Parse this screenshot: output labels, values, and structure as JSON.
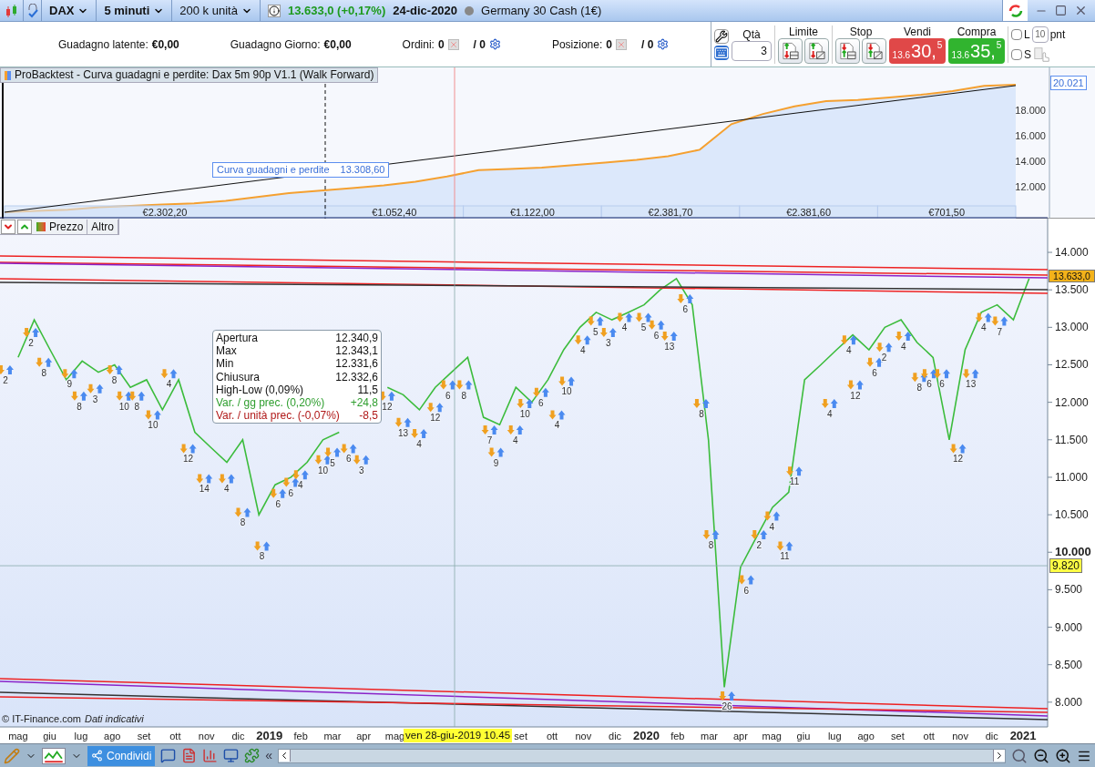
{
  "toolbar": {
    "symbol": "DAX",
    "timeframe": "5 minuti",
    "units": "200 k unità",
    "quote": "13.633,0 (+0,17%)",
    "date": "24-dic-2020",
    "instrument": "Germany 30 Cash (1€)"
  },
  "account": [
    {
      "kind": "value",
      "label": "Guadagno latente:",
      "value": "€0,00"
    },
    {
      "kind": "value",
      "label": "Guadagno Giorno:",
      "value": "€0,00"
    },
    {
      "kind": "count",
      "label": "Ordini:",
      "value": "0",
      "pending": "/ 0"
    },
    {
      "kind": "count",
      "label": "Posizione:",
      "value": "0",
      "pending": "/ 0"
    }
  ],
  "order_panel": {
    "qty_label": "Qtà",
    "qty": "3",
    "limit_label": "Limite",
    "stop_label": "Stop",
    "sell": {
      "label": "Vendi",
      "prefix": "13.6",
      "big": "30,",
      "fraction": "5"
    },
    "buy": {
      "label": "Compra",
      "prefix": "13.6",
      "big": "35,",
      "fraction": "5"
    },
    "options": [
      {
        "label": "L",
        "checked": false
      },
      {
        "label": "S",
        "checked": false
      }
    ],
    "points": "10",
    "points_unit": "pnt"
  },
  "equity_pane": {
    "title": "ProBacktest - Curva guadagni e perdite: Dax 5m 90p V1.1 (Walk Forward)",
    "tooltip_value": "13.308,60",
    "last_value": "20.021",
    "periods": [
      "€2.302,20",
      "€1.052,40",
      "€1.122,00",
      "€2.381,70",
      "€2.381,60",
      "€701,50"
    ],
    "chart_data": {
      "type": "area",
      "categories": [
        null,
        null,
        null,
        null,
        null,
        null,
        null,
        null,
        null,
        null,
        null,
        null,
        null,
        null,
        null,
        null,
        null,
        null,
        null,
        null,
        null,
        null,
        null,
        null,
        null,
        null,
        null,
        null,
        null,
        null,
        null,
        null,
        null
      ],
      "series": [
        {
          "name": "Curva guadagni e perdite",
          "color": "#f5a030",
          "values": [
            10000,
            10100,
            10200,
            10400,
            10500,
            10600,
            10700,
            10900,
            11200,
            11500,
            11700,
            11900,
            12100,
            12400,
            12800,
            13300,
            13400,
            13500,
            13700,
            13900,
            14100,
            14400,
            14900,
            16900,
            17700,
            18300,
            18700,
            18800,
            19000,
            19200,
            19500,
            19900,
            20000
          ]
        }
      ],
      "ylim": [
        9500,
        21350
      ],
      "yticks": [
        {
          "value": 12000,
          "label": "12.000"
        },
        {
          "value": 14000,
          "label": "14.000"
        },
        {
          "value": 16000,
          "label": "16.000"
        },
        {
          "value": 18000,
          "label": "18.000"
        }
      ]
    }
  },
  "price_tabs": [
    "Prezzo",
    "Altro"
  ],
  "price_pane": {
    "last_price": "13.633,0",
    "cursor_price": "9.820",
    "cursor_date": "ven 28-giu-2019 10.45",
    "copyright": "© IT-Finance.com",
    "disclaimer": "Dati indicativi",
    "tooltip": [
      {
        "kind": "plain",
        "label": "Apertura",
        "value": "12.340,9"
      },
      {
        "kind": "plain",
        "label": "Max",
        "value": "12.343,1"
      },
      {
        "kind": "plain",
        "label": "Min",
        "value": "12.331,6"
      },
      {
        "kind": "plain",
        "label": "Chiusura",
        "value": "12.332,6"
      },
      {
        "kind": "plain",
        "label": "High-Low (0,09%)",
        "value": "11,5"
      },
      {
        "kind": "up",
        "label": "Var. / gg prec. (0,20%)",
        "value": "+24,8"
      },
      {
        "kind": "down",
        "label": "Var. / unità prec. (-0,07%)",
        "value": "-8,5"
      }
    ],
    "trade_markers": [
      "2",
      "2",
      "8",
      "9",
      "8",
      "3",
      "8",
      "10",
      "8",
      "10",
      "4",
      "12",
      "14",
      "4",
      "8",
      "8",
      "6",
      "6",
      "4",
      "10",
      "5",
      "6",
      "3",
      "12",
      "13",
      "4",
      "12",
      "6",
      "8",
      "7",
      "9",
      "4",
      "10",
      "6",
      "4",
      "10",
      "4",
      "5",
      "3",
      "4",
      "5",
      "6",
      "13",
      "6",
      "8",
      "8",
      "26",
      "6",
      "2",
      "4",
      "11",
      "11",
      "4",
      "4",
      "12",
      "6",
      "2",
      "4",
      "8",
      "6",
      "6",
      "12",
      "13",
      "4",
      "7"
    ],
    "chart_data": {
      "type": "line",
      "x": [
        2018.333,
        2018.376,
        2018.418,
        2018.461,
        2018.503,
        2018.546,
        2018.589,
        2018.631,
        2018.674,
        2018.716,
        2018.759,
        2018.802,
        2018.844,
        2018.887,
        2018.929,
        2018.972,
        2019.015,
        2019.057,
        2019.1,
        2019.142,
        2019.185,
        2019.228,
        2019.27,
        2019.313,
        2019.355,
        2019.398,
        2019.44,
        2019.483,
        2019.526,
        2019.568,
        2019.611,
        2019.654,
        2019.696,
        2019.739,
        2019.781,
        2019.824,
        2019.867,
        2019.909,
        2019.952,
        2019.994,
        2020.037,
        2020.08,
        2020.122,
        2020.165,
        2020.207,
        2020.25,
        2020.292,
        2020.335,
        2020.378,
        2020.42,
        2020.463,
        2020.505,
        2020.548,
        2020.591,
        2020.633,
        2020.676,
        2020.718,
        2020.761,
        2020.804,
        2020.846,
        2020.889,
        2020.931,
        2020.974,
        2021.016
      ],
      "series": [
        {
          "color": "#3cbc3c",
          "values": [
            12600,
            13100,
            12700,
            12300,
            12550,
            12400,
            12500,
            12200,
            12300,
            11900,
            12300,
            11600,
            11400,
            11200,
            11500,
            10500,
            10900,
            11000,
            11200,
            11500,
            11600,
            null,
            null,
            12200,
            12100,
            11900,
            12200,
            12400,
            12600,
            11800,
            11700,
            12200,
            12000,
            12300,
            12700,
            13000,
            13200,
            13100,
            13200,
            13300,
            13500,
            13650,
            13300,
            11500,
            8200,
            9800,
            10200,
            10600,
            10800,
            12300,
            12500,
            12700,
            12900,
            12700,
            13000,
            13100,
            12800,
            12600,
            11500,
            12700,
            13200,
            13300,
            13100,
            13650
          ]
        }
      ],
      "xlim": [
        2018.285,
        2021.065
      ],
      "ylim": [
        7670,
        14450
      ],
      "xticks": [
        {
          "value": 2018.333,
          "label": "mag"
        },
        {
          "value": 2018.417,
          "label": "giu"
        },
        {
          "value": 2018.5,
          "label": "lug"
        },
        {
          "value": 2018.583,
          "label": "ago"
        },
        {
          "value": 2018.667,
          "label": "set"
        },
        {
          "value": 2018.75,
          "label": "ott"
        },
        {
          "value": 2018.833,
          "label": "nov"
        },
        {
          "value": 2018.917,
          "label": "dic"
        },
        2019,
        {
          "value": 2019.083,
          "label": "feb"
        },
        {
          "value": 2019.167,
          "label": "mar"
        },
        {
          "value": 2019.25,
          "label": "apr"
        },
        {
          "value": 2019.333,
          "label": "mag"
        },
        {
          "value": 2019.667,
          "label": "set"
        },
        {
          "value": 2019.75,
          "label": "ott"
        },
        {
          "value": 2019.833,
          "label": "nov"
        },
        {
          "value": 2019.917,
          "label": "dic"
        },
        2020,
        {
          "value": 2020.083,
          "label": "feb"
        },
        {
          "value": 2020.167,
          "label": "mar"
        },
        {
          "value": 2020.25,
          "label": "apr"
        },
        {
          "value": 2020.333,
          "label": "mag"
        },
        {
          "value": 2020.417,
          "label": "giu"
        },
        {
          "value": 2020.5,
          "label": "lug"
        },
        {
          "value": 2020.583,
          "label": "ago"
        },
        {
          "value": 2020.667,
          "label": "set"
        },
        {
          "value": 2020.75,
          "label": "ott"
        },
        {
          "value": 2020.833,
          "label": "nov"
        },
        {
          "value": 2020.917,
          "label": "dic"
        },
        2021
      ],
      "yticks": [
        {
          "value": 8000,
          "label": "8.000"
        },
        {
          "value": 8500,
          "label": "8.500"
        },
        {
          "value": 9000,
          "label": "9.000"
        },
        {
          "value": 9500,
          "label": "9.500"
        },
        {
          "value": 10000,
          "label": "10.000"
        },
        {
          "value": 10500,
          "label": "10.500"
        },
        {
          "value": 11000,
          "label": "11.000"
        },
        {
          "value": 11500,
          "label": "11.500"
        },
        {
          "value": 12000,
          "label": "12.000"
        },
        {
          "value": 12500,
          "label": "12.500"
        },
        {
          "value": 13000,
          "label": "13.000"
        },
        {
          "value": 13500,
          "label": "13.500"
        },
        {
          "value": 14000,
          "label": "14.000"
        }
      ]
    }
  },
  "bottom_toolbar": {
    "share": "Condividi",
    "collapse": "«"
  }
}
